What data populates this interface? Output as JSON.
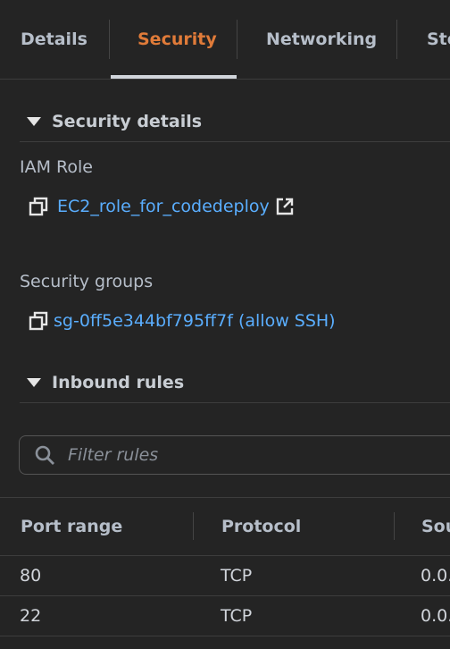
{
  "tabs": [
    {
      "label": "Details"
    },
    {
      "label": "Security"
    },
    {
      "label": "Networking"
    },
    {
      "label": "Sto"
    }
  ],
  "security_details": {
    "title": "Security details",
    "iam_role_label": "IAM Role",
    "iam_role_link": "EC2_role_for_codedeploy",
    "security_groups_label": "Security groups",
    "security_group_link": "sg-0ff5e344bf795ff7f (allow SSH)"
  },
  "inbound_rules": {
    "title": "Inbound rules",
    "filter_placeholder": "Filter rules",
    "columns": [
      "Port range",
      "Protocol",
      "Sou"
    ],
    "rows": [
      {
        "port": "80",
        "protocol": "TCP",
        "source": "0.0."
      },
      {
        "port": "22",
        "protocol": "TCP",
        "source": "0.0."
      }
    ]
  },
  "colors": {
    "background": "#242424",
    "accent": "#e07b39",
    "link": "#5aaeff"
  }
}
